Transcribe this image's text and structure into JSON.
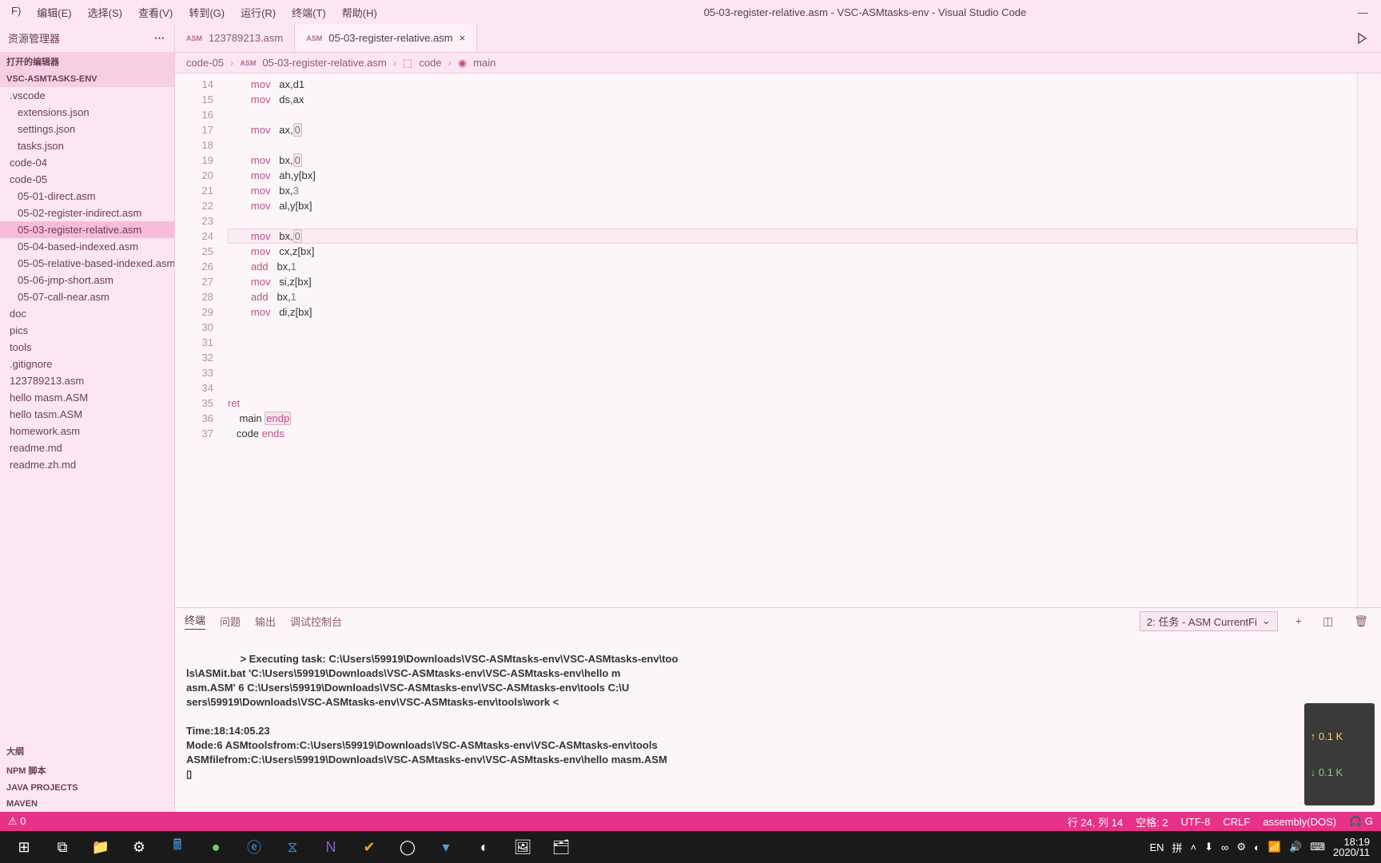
{
  "titlebar": {
    "menu": [
      "F)",
      "编辑(E)",
      "选择(S)",
      "查看(V)",
      "转到(G)",
      "运行(R)",
      "终端(T)",
      "帮助(H)"
    ],
    "title": "05-03-register-relative.asm - VSC-ASMtasks-env - Visual Studio Code"
  },
  "explorer": {
    "header": "资源管理器",
    "openEditorsTitle": "打开的编辑器",
    "workspaceTitle": "VSC-ASMTASKS-ENV",
    "tree": [
      {
        "label": ".vscode",
        "indent": 0
      },
      {
        "label": "extensions.json",
        "indent": 1
      },
      {
        "label": "settings.json",
        "indent": 1
      },
      {
        "label": "tasks.json",
        "indent": 1
      },
      {
        "label": "code-04",
        "indent": 0
      },
      {
        "label": "code-05",
        "indent": 0
      },
      {
        "label": "05-01-direct.asm",
        "indent": 1
      },
      {
        "label": "05-02-register-indirect.asm",
        "indent": 1
      },
      {
        "label": "05-03-register-relative.asm",
        "indent": 1,
        "selected": true
      },
      {
        "label": "05-04-based-indexed.asm",
        "indent": 1
      },
      {
        "label": "05-05-relative-based-indexed.asm",
        "indent": 1
      },
      {
        "label": "05-06-jmp-short.asm",
        "indent": 1
      },
      {
        "label": "05-07-call-near.asm",
        "indent": 1
      },
      {
        "label": "doc",
        "indent": 0
      },
      {
        "label": "pics",
        "indent": 0
      },
      {
        "label": "tools",
        "indent": 0
      },
      {
        "label": ".gitignore",
        "indent": 0
      },
      {
        "label": "123789213.asm",
        "indent": 0
      },
      {
        "label": "hello masm.ASM",
        "indent": 0
      },
      {
        "label": "hello tasm.ASM",
        "indent": 0
      },
      {
        "label": "homework.asm",
        "indent": 0
      },
      {
        "label": "readme.md",
        "indent": 0
      },
      {
        "label": "readme.zh.md",
        "indent": 0
      }
    ],
    "bottom": [
      "大纲",
      "NPM 脚本",
      "JAVA PROJECTS",
      "MAVEN"
    ]
  },
  "tabs": {
    "list": [
      {
        "label": "123789213.asm",
        "active": false
      },
      {
        "label": "05-03-register-relative.asm",
        "active": true
      }
    ]
  },
  "breadcrumb": [
    "code-05",
    "05-03-register-relative.asm",
    "code",
    "main"
  ],
  "code": {
    "startLine": 14,
    "lines": [
      {
        "html": "        <span class='kw'>mov</span>   ax,d1"
      },
      {
        "html": "        <span class='kw'>mov</span>   ds,ax"
      },
      {
        "html": ""
      },
      {
        "html": "        <span class='kw'>mov</span>   ax,<span class='num box'>0</span>"
      },
      {
        "html": ""
      },
      {
        "html": "        <span class='kw'>mov</span>   bx,<span class='num box'>0</span>"
      },
      {
        "html": "        <span class='kw'>mov</span>   ah,y[bx]"
      },
      {
        "html": "        <span class='kw'>mov</span>   bx,<span class='num'>3</span>"
      },
      {
        "html": "        <span class='kw'>mov</span>   al,y[bx]"
      },
      {
        "html": ""
      },
      {
        "html": "        <span class='kw'>mov</span>   bx,<span class='num box'>0</span>",
        "current": true
      },
      {
        "html": "        <span class='kw'>mov</span>   cx,z[bx]"
      },
      {
        "html": "        <span class='kw'>add</span>   bx,<span class='num'>1</span>"
      },
      {
        "html": "        <span class='kw'>mov</span>   si,z[bx]"
      },
      {
        "html": "        <span class='kw'>add</span>   bx,<span class='num'>1</span>"
      },
      {
        "html": "        <span class='kw'>mov</span>   di,z[bx]"
      },
      {
        "html": ""
      },
      {
        "html": ""
      },
      {
        "html": ""
      },
      {
        "html": ""
      },
      {
        "html": ""
      },
      {
        "html": "<span class='kw'>ret</span>"
      },
      {
        "html": "    main <span class='kw box'>endp</span>"
      },
      {
        "html": "   code <span class='kw'>ends</span>"
      }
    ]
  },
  "panel": {
    "tabs": [
      "终端",
      "问题",
      "输出",
      "调试控制台"
    ],
    "task": "2: 任务 - ASM CurrentFi",
    "content": "> Executing task: C:\\Users\\59919\\Downloads\\VSC-ASMtasks-env\\VSC-ASMtasks-env\\too\nls\\ASMit.bat 'C:\\Users\\59919\\Downloads\\VSC-ASMtasks-env\\VSC-ASMtasks-env\\hello m\nasm.ASM' 6 C:\\Users\\59919\\Downloads\\VSC-ASMtasks-env\\VSC-ASMtasks-env\\tools C:\\U\nsers\\59919\\Downloads\\VSC-ASMtasks-env\\VSC-ASMtasks-env\\tools\\work <\n\nTime:18:14:05.23\nMode:6 ASMtoolsfrom:C:\\Users\\59919\\Downloads\\VSC-ASMtasks-env\\VSC-ASMtasks-env\\tools\nASMfilefrom:C:\\Users\\59919\\Downloads\\VSC-ASMtasks-env\\VSC-ASMtasks-env\\hello masm.ASM\n▯",
    "net": {
      "up": "↑ 0.1 K",
      "down": "↓ 0.1 K"
    }
  },
  "status": {
    "warn": "⚠ 0",
    "items": [
      "行 24, 列 14",
      "空格: 2",
      "UTF-8",
      "CRLF",
      "assembly(DOS)",
      "🎧 G"
    ]
  },
  "taskbar": {
    "time": "18:19",
    "date": "2020/11",
    "ime": "EN",
    "lang": "拼"
  }
}
